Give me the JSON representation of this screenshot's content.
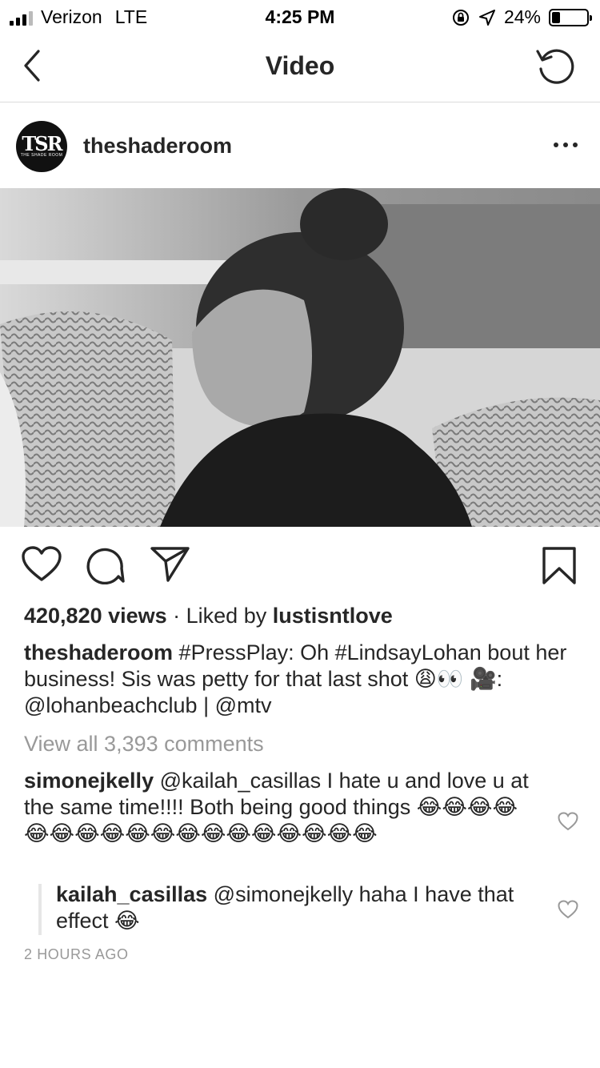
{
  "status_bar": {
    "carrier": "Verizon",
    "network": "LTE",
    "time": "4:25 PM",
    "battery_percent": "24%",
    "battery_level": 0.24
  },
  "nav": {
    "title": "Video",
    "back_icon": "chevron-left-icon",
    "refresh_icon": "refresh-icon"
  },
  "post": {
    "username": "theshaderoom",
    "avatar_text": "TSR",
    "avatar_subtext": "THE SHADE ROOM"
  },
  "stats": {
    "views": "420,820 views",
    "separator": " · Liked by ",
    "liked_by": "lustisntlove"
  },
  "caption": {
    "username": "theshaderoom",
    "text": " #PressPlay: Oh #LindsayLohan bout her business! Sis was petty for that last shot 😩👀 🎥: @lohanbeachclub | @mtv"
  },
  "view_all_comments": "View all 3,393 comments",
  "comments": [
    {
      "username": "simonejkelly",
      "text": " @kailah_casillas I hate u and love u at the same time!!!! Both being good things 😂😂😂😂😂😂😂😂😂😂😂😂😂😂😂😂😂😂"
    }
  ],
  "reply": {
    "username": "kailah_casillas",
    "text": " @simonejkelly haha I have that effect 😂"
  },
  "timestamp": "2 HOURS AGO",
  "colors": {
    "text": "#262626",
    "muted": "#999999",
    "divider": "#dbdbdb"
  }
}
